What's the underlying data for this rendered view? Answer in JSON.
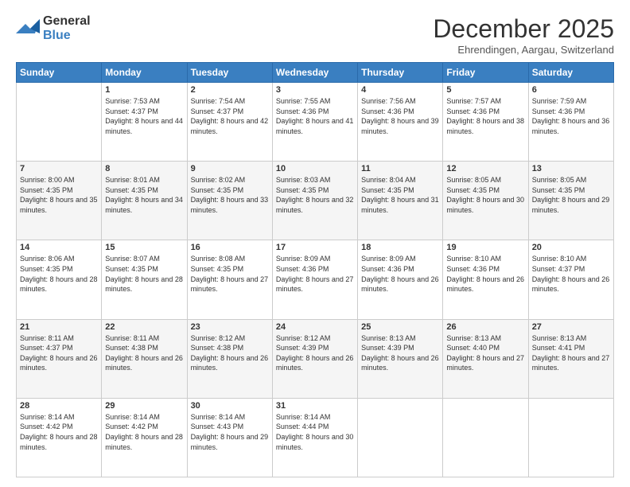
{
  "header": {
    "logo_general": "General",
    "logo_blue": "Blue",
    "month_title": "December 2025",
    "location": "Ehrendingen, Aargau, Switzerland"
  },
  "weekdays": [
    "Sunday",
    "Monday",
    "Tuesday",
    "Wednesday",
    "Thursday",
    "Friday",
    "Saturday"
  ],
  "weeks": [
    [
      {
        "day": "",
        "sunrise": "",
        "sunset": "",
        "daylight": ""
      },
      {
        "day": "1",
        "sunrise": "Sunrise: 7:53 AM",
        "sunset": "Sunset: 4:37 PM",
        "daylight": "Daylight: 8 hours and 44 minutes."
      },
      {
        "day": "2",
        "sunrise": "Sunrise: 7:54 AM",
        "sunset": "Sunset: 4:37 PM",
        "daylight": "Daylight: 8 hours and 42 minutes."
      },
      {
        "day": "3",
        "sunrise": "Sunrise: 7:55 AM",
        "sunset": "Sunset: 4:36 PM",
        "daylight": "Daylight: 8 hours and 41 minutes."
      },
      {
        "day": "4",
        "sunrise": "Sunrise: 7:56 AM",
        "sunset": "Sunset: 4:36 PM",
        "daylight": "Daylight: 8 hours and 39 minutes."
      },
      {
        "day": "5",
        "sunrise": "Sunrise: 7:57 AM",
        "sunset": "Sunset: 4:36 PM",
        "daylight": "Daylight: 8 hours and 38 minutes."
      },
      {
        "day": "6",
        "sunrise": "Sunrise: 7:59 AM",
        "sunset": "Sunset: 4:36 PM",
        "daylight": "Daylight: 8 hours and 36 minutes."
      }
    ],
    [
      {
        "day": "7",
        "sunrise": "Sunrise: 8:00 AM",
        "sunset": "Sunset: 4:35 PM",
        "daylight": "Daylight: 8 hours and 35 minutes."
      },
      {
        "day": "8",
        "sunrise": "Sunrise: 8:01 AM",
        "sunset": "Sunset: 4:35 PM",
        "daylight": "Daylight: 8 hours and 34 minutes."
      },
      {
        "day": "9",
        "sunrise": "Sunrise: 8:02 AM",
        "sunset": "Sunset: 4:35 PM",
        "daylight": "Daylight: 8 hours and 33 minutes."
      },
      {
        "day": "10",
        "sunrise": "Sunrise: 8:03 AM",
        "sunset": "Sunset: 4:35 PM",
        "daylight": "Daylight: 8 hours and 32 minutes."
      },
      {
        "day": "11",
        "sunrise": "Sunrise: 8:04 AM",
        "sunset": "Sunset: 4:35 PM",
        "daylight": "Daylight: 8 hours and 31 minutes."
      },
      {
        "day": "12",
        "sunrise": "Sunrise: 8:05 AM",
        "sunset": "Sunset: 4:35 PM",
        "daylight": "Daylight: 8 hours and 30 minutes."
      },
      {
        "day": "13",
        "sunrise": "Sunrise: 8:05 AM",
        "sunset": "Sunset: 4:35 PM",
        "daylight": "Daylight: 8 hours and 29 minutes."
      }
    ],
    [
      {
        "day": "14",
        "sunrise": "Sunrise: 8:06 AM",
        "sunset": "Sunset: 4:35 PM",
        "daylight": "Daylight: 8 hours and 28 minutes."
      },
      {
        "day": "15",
        "sunrise": "Sunrise: 8:07 AM",
        "sunset": "Sunset: 4:35 PM",
        "daylight": "Daylight: 8 hours and 28 minutes."
      },
      {
        "day": "16",
        "sunrise": "Sunrise: 8:08 AM",
        "sunset": "Sunset: 4:35 PM",
        "daylight": "Daylight: 8 hours and 27 minutes."
      },
      {
        "day": "17",
        "sunrise": "Sunrise: 8:09 AM",
        "sunset": "Sunset: 4:36 PM",
        "daylight": "Daylight: 8 hours and 27 minutes."
      },
      {
        "day": "18",
        "sunrise": "Sunrise: 8:09 AM",
        "sunset": "Sunset: 4:36 PM",
        "daylight": "Daylight: 8 hours and 26 minutes."
      },
      {
        "day": "19",
        "sunrise": "Sunrise: 8:10 AM",
        "sunset": "Sunset: 4:36 PM",
        "daylight": "Daylight: 8 hours and 26 minutes."
      },
      {
        "day": "20",
        "sunrise": "Sunrise: 8:10 AM",
        "sunset": "Sunset: 4:37 PM",
        "daylight": "Daylight: 8 hours and 26 minutes."
      }
    ],
    [
      {
        "day": "21",
        "sunrise": "Sunrise: 8:11 AM",
        "sunset": "Sunset: 4:37 PM",
        "daylight": "Daylight: 8 hours and 26 minutes."
      },
      {
        "day": "22",
        "sunrise": "Sunrise: 8:11 AM",
        "sunset": "Sunset: 4:38 PM",
        "daylight": "Daylight: 8 hours and 26 minutes."
      },
      {
        "day": "23",
        "sunrise": "Sunrise: 8:12 AM",
        "sunset": "Sunset: 4:38 PM",
        "daylight": "Daylight: 8 hours and 26 minutes."
      },
      {
        "day": "24",
        "sunrise": "Sunrise: 8:12 AM",
        "sunset": "Sunset: 4:39 PM",
        "daylight": "Daylight: 8 hours and 26 minutes."
      },
      {
        "day": "25",
        "sunrise": "Sunrise: 8:13 AM",
        "sunset": "Sunset: 4:39 PM",
        "daylight": "Daylight: 8 hours and 26 minutes."
      },
      {
        "day": "26",
        "sunrise": "Sunrise: 8:13 AM",
        "sunset": "Sunset: 4:40 PM",
        "daylight": "Daylight: 8 hours and 27 minutes."
      },
      {
        "day": "27",
        "sunrise": "Sunrise: 8:13 AM",
        "sunset": "Sunset: 4:41 PM",
        "daylight": "Daylight: 8 hours and 27 minutes."
      }
    ],
    [
      {
        "day": "28",
        "sunrise": "Sunrise: 8:14 AM",
        "sunset": "Sunset: 4:42 PM",
        "daylight": "Daylight: 8 hours and 28 minutes."
      },
      {
        "day": "29",
        "sunrise": "Sunrise: 8:14 AM",
        "sunset": "Sunset: 4:42 PM",
        "daylight": "Daylight: 8 hours and 28 minutes."
      },
      {
        "day": "30",
        "sunrise": "Sunrise: 8:14 AM",
        "sunset": "Sunset: 4:43 PM",
        "daylight": "Daylight: 8 hours and 29 minutes."
      },
      {
        "day": "31",
        "sunrise": "Sunrise: 8:14 AM",
        "sunset": "Sunset: 4:44 PM",
        "daylight": "Daylight: 8 hours and 30 minutes."
      },
      {
        "day": "",
        "sunrise": "",
        "sunset": "",
        "daylight": ""
      },
      {
        "day": "",
        "sunrise": "",
        "sunset": "",
        "daylight": ""
      },
      {
        "day": "",
        "sunrise": "",
        "sunset": "",
        "daylight": ""
      }
    ]
  ]
}
